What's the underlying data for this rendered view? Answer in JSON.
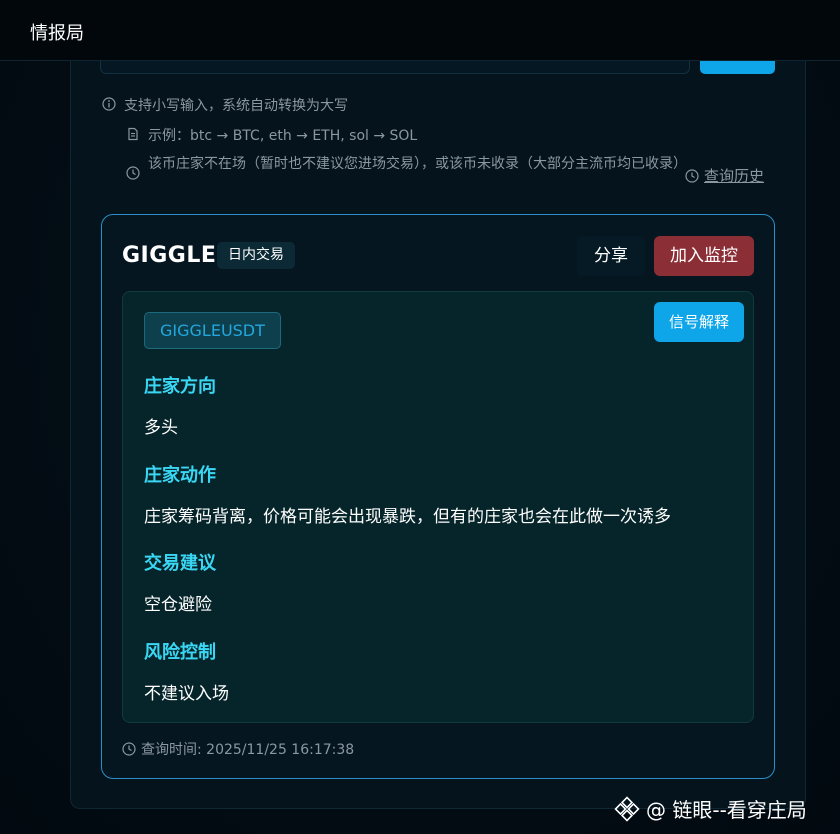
{
  "app": {
    "title": "情报局"
  },
  "hints": {
    "lowercase": "支持小写输入，系统自动转换为大写",
    "example": "示例：btc → BTC, eth → ETH, sol → SOL",
    "notice": "该币庄家不在场（暂时也不建议您进场交易），或该币未收录（大部分主流币均已收录）",
    "history_link": "查询历史"
  },
  "result": {
    "symbol": "GIGGLE",
    "type_badge": "日内交易",
    "share_label": "分享",
    "monitor_label": "加入监控",
    "pair": "GIGGLEUSDT",
    "explain_label": "信号解释",
    "sections": [
      {
        "label": "庄家方向",
        "value": "多头"
      },
      {
        "label": "庄家动作",
        "value": "庄家筹码背离，价格可能会出现暴跌，但有的庄家也会在此做一次诱多"
      },
      {
        "label": "交易建议",
        "value": "空仓避险"
      },
      {
        "label": "风险控制",
        "value": "不建议入场"
      }
    ],
    "query_time": "查询时间: 2025/11/25 16:17:38"
  },
  "watermark": "@ 链眼--看穿庄局",
  "colors": {
    "accent": "#0ea5e9",
    "monitor": "#8b2e36",
    "section_label": "#3ad7f5",
    "card_border": "#2b8fc9"
  },
  "icons": {
    "hint_lowercase": "info-icon",
    "hint_example": "document-icon",
    "hint_notice": "clock-icon",
    "history": "clock-icon",
    "query_time": "clock-icon",
    "watermark": "binance-logo-icon"
  }
}
